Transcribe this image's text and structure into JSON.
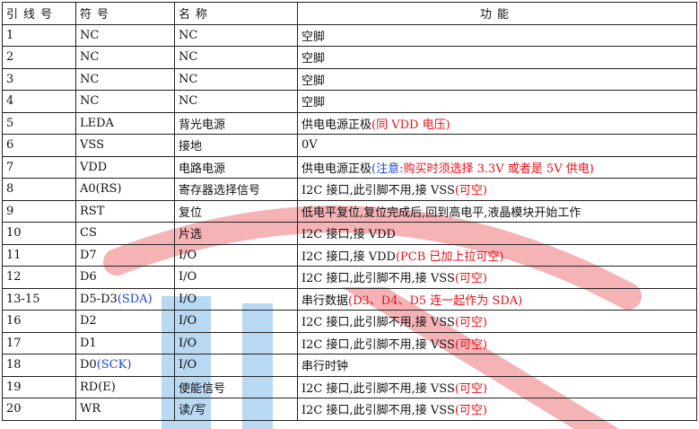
{
  "headers": {
    "pin": "引线号",
    "symbol": "符号",
    "name": "名称",
    "function": "功能"
  },
  "rows": [
    {
      "pin": "1",
      "symbol": "NC",
      "name": "NC",
      "function": "空脚"
    },
    {
      "pin": "2",
      "symbol": "NC",
      "name": "NC",
      "function": "空脚"
    },
    {
      "pin": "3",
      "symbol": "NC",
      "name": "NC",
      "function": "空脚"
    },
    {
      "pin": "4",
      "symbol": "NC",
      "name": "NC",
      "function": "空脚"
    },
    {
      "pin": "5",
      "symbol": "LEDA",
      "name": "背光电源",
      "function": "供电电源正极",
      "note": "(同 VDD 电压)",
      "note_color": "red"
    },
    {
      "pin": "6",
      "symbol": "VSS",
      "name": "接地",
      "function": "0V"
    },
    {
      "pin": "7",
      "symbol": "VDD",
      "name": "电路电源",
      "function": "供电电源正极",
      "note": "(注意:购买时须选择 3.3V 或者是 5V 供电)",
      "note_color": "red",
      "note_prefix": "(注意:",
      "note_prefix_color": "blue",
      "note_rest": "购买时须选择 3.3V 或者是 5V 供电)"
    },
    {
      "pin": "8",
      "symbol": "A0(RS)",
      "name": "寄存器选择信号",
      "function": "I2C 接口,此引脚不用,接 VSS",
      "note": "(可空)",
      "note_color": "red"
    },
    {
      "pin": "9",
      "symbol": "RST",
      "name": "复位",
      "function": "低电平复位,复位完成后,回到高电平,液晶模块开始工作"
    },
    {
      "pin": "10",
      "symbol": "CS",
      "name": "片选",
      "function": "I2C 接口,接 VDD"
    },
    {
      "pin": "11",
      "symbol": "D7",
      "name": "I/O",
      "function": "I2C 接口,接 VDD",
      "note": "(PCB 已加上拉可空)",
      "note_color": "red"
    },
    {
      "pin": "12",
      "symbol": "D6",
      "name": "I/O",
      "function": "I2C 接口,此引脚不用,接 VSS",
      "note": "(可空)",
      "note_color": "red"
    },
    {
      "pin": "13-15",
      "symbol": "D5-D3",
      "symbol_note": "(SDA)",
      "name": "I/O",
      "function": "串行数据",
      "note": "(D3、D4、D5 连一起作为 SDA)",
      "note_color": "red"
    },
    {
      "pin": "16",
      "symbol": "D2",
      "name": "I/O",
      "function": "I2C 接口,此引脚不用,接 VSS",
      "note": "(可空)",
      "note_color": "red"
    },
    {
      "pin": "17",
      "symbol": "D1",
      "name": "I/O",
      "function": "I2C 接口,此引脚不用,接 VSS",
      "note": "(可空)",
      "note_color": "red"
    },
    {
      "pin": "18",
      "symbol": "D0",
      "symbol_note": "(SCK)",
      "name": "I/O",
      "function": "串行时钟"
    },
    {
      "pin": "19",
      "symbol": "RD(E)",
      "name": "使能信号",
      "function": "I2C 接口,此引脚不用,接 VSS",
      "note": "(可空)",
      "note_color": "red"
    },
    {
      "pin": "20",
      "symbol": "WR",
      "name": "读/写",
      "function": "I2C 接口,此引脚不用,接 VSS",
      "note": "(可空)",
      "note_color": "red"
    }
  ],
  "colors": {
    "red": "#e8101a",
    "blue": "#1a4ad8",
    "watermark_red": "#f6b3b6",
    "watermark_blue": "#b9d8f2"
  }
}
